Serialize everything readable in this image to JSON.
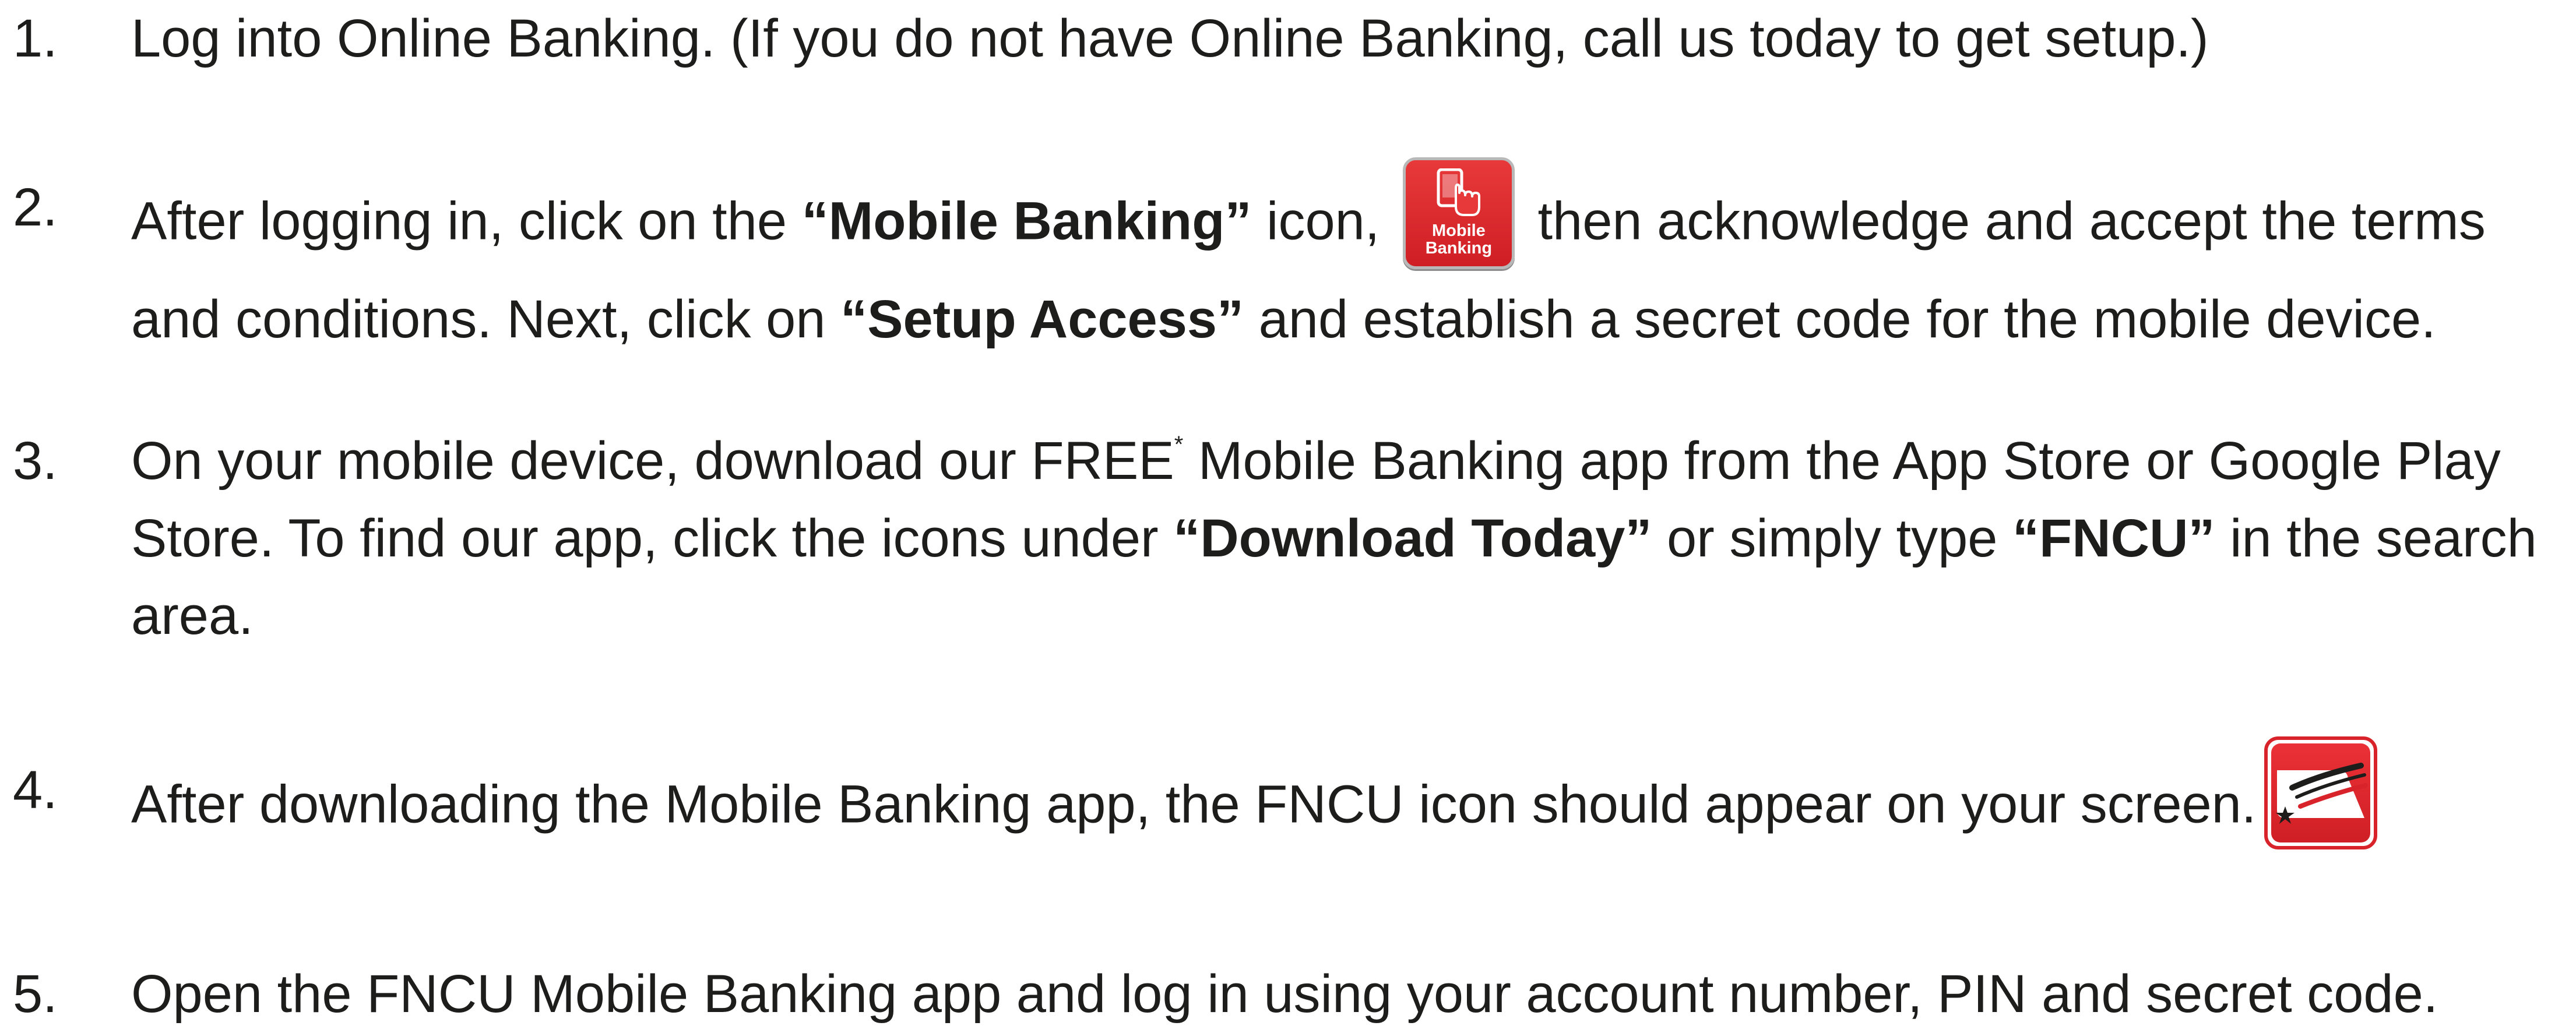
{
  "steps": [
    {
      "number": "1.",
      "text": "Log into Online Banking. (If you do not have Online Banking, call us today to get setup.)"
    },
    {
      "number": "2.",
      "part1": "After logging in, click on the ",
      "bold1": "“Mobile Banking”",
      "part2": " icon, ",
      "icon_label_line1": "Mobile",
      "icon_label_line2": "Banking",
      "part3": " then acknowledge and accept the terms and conditions. Next, click on ",
      "bold2": "“Setup Access”",
      "part4": " and establish a secret code for the mobile device."
    },
    {
      "number": "3.",
      "part1": "On your mobile device, download our FREE",
      "sup": "*",
      "part2": " Mobile Banking app from the App Store or Google Play Store. To find our app, click the icons under ",
      "bold1": "“Download Today”",
      "part3": " or simply type ",
      "bold2": "“FNCU”",
      "part4": " in the search area."
    },
    {
      "number": "4.",
      "text": "After downloading the Mobile Banking app, the FNCU icon should appear on your screen."
    },
    {
      "number": "5.",
      "text": "Open the FNCU Mobile Banking app and log in using your account number, PIN and secret code."
    }
  ],
  "colors": {
    "text": "#1d1d1b",
    "icon_red": "#d9232a"
  },
  "icons": {
    "mobile_banking": "phone-tap-icon",
    "fncu": "fncu-flag-icon"
  }
}
